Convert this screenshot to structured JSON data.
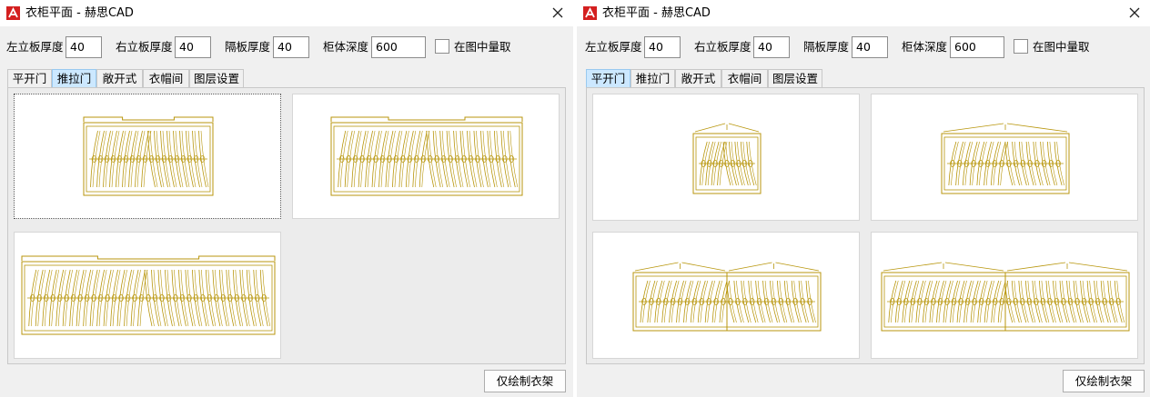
{
  "dialogs": [
    {
      "title": "衣柜平面 - 赫思CAD",
      "fields": [
        {
          "label": "左立板厚度",
          "value": "40"
        },
        {
          "label": "右立板厚度",
          "value": "40"
        },
        {
          "label": "隔板厚度",
          "value": "40"
        },
        {
          "label": "柜体深度",
          "value": "600"
        }
      ],
      "checkbox_label": "在图中量取",
      "tabs": [
        "平开门",
        "推拉门",
        "敞开式",
        "衣帽间",
        "图层设置"
      ],
      "active_tab": "推拉门",
      "draw_button": "仅绘制衣架"
    },
    {
      "title": "衣柜平面 - 赫思CAD",
      "fields": [
        {
          "label": "左立板厚度",
          "value": "40"
        },
        {
          "label": "右立板厚度",
          "value": "40"
        },
        {
          "label": "隔板厚度",
          "value": "40"
        },
        {
          "label": "柜体深度",
          "value": "600"
        }
      ],
      "checkbox_label": "在图中量取",
      "tabs": [
        "平开门",
        "推拉门",
        "敞开式",
        "衣帽间",
        "图层设置"
      ],
      "active_tab": "平开门",
      "draw_button": "仅绘制衣架"
    }
  ],
  "colors": {
    "drawing": "#b8960c",
    "accent_tab": "#cce8ff",
    "title_icon": "#d42020"
  },
  "icons": {
    "app": "autocad-a-icon",
    "close": "close-x-icon"
  }
}
